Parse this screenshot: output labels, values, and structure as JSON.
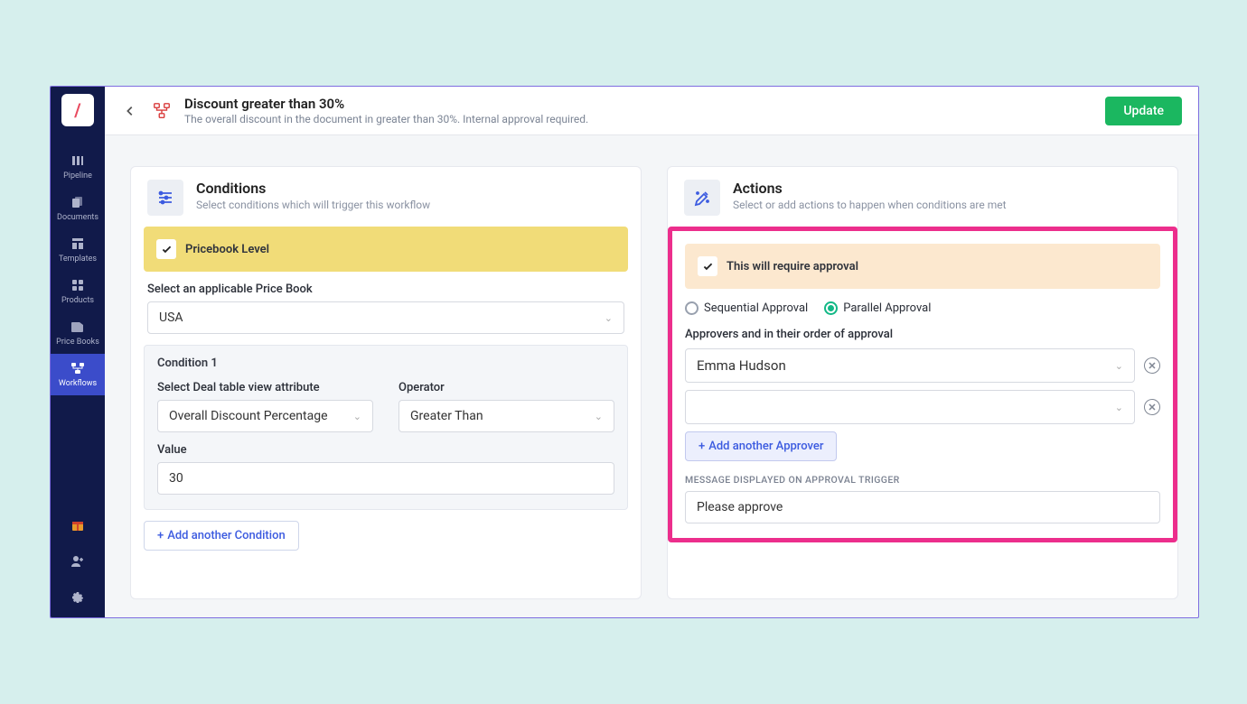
{
  "sidebar": {
    "items": [
      {
        "label": "Pipeline"
      },
      {
        "label": "Documents"
      },
      {
        "label": "Templates"
      },
      {
        "label": "Products"
      },
      {
        "label": "Price Books"
      },
      {
        "label": "Workflows"
      }
    ]
  },
  "header": {
    "title": "Discount greater than 30%",
    "subtitle": "The overall discount in the document in greater than 30%. Internal approval required.",
    "update_label": "Update"
  },
  "conditions": {
    "title": "Conditions",
    "subtitle": "Select conditions which will trigger this workflow",
    "banner_label": "Pricebook Level",
    "pricebook_label": "Select an applicable Price Book",
    "pricebook_value": "USA",
    "condition_title": "Condition 1",
    "attr_label": "Select Deal table view attribute",
    "attr_value": "Overall Discount Percentage",
    "operator_label": "Operator",
    "operator_value": "Greater Than",
    "value_label": "Value",
    "value_value": "30",
    "add_condition_label": "Add another Condition"
  },
  "actions": {
    "title": "Actions",
    "subtitle": "Select or add actions to happen when conditions are met",
    "banner_label": "This will require approval",
    "approval_type": {
      "sequential_label": "Sequential Approval",
      "parallel_label": "Parallel Approval",
      "selected": "parallel"
    },
    "approvers_label": "Approvers and in their order of approval",
    "approvers": [
      {
        "name": "Emma Hudson"
      },
      {
        "name": ""
      }
    ],
    "add_approver_label": "Add another Approver",
    "message_label": "MESSAGE DISPLAYED ON APPROVAL TRIGGER",
    "message_value": "Please approve"
  }
}
